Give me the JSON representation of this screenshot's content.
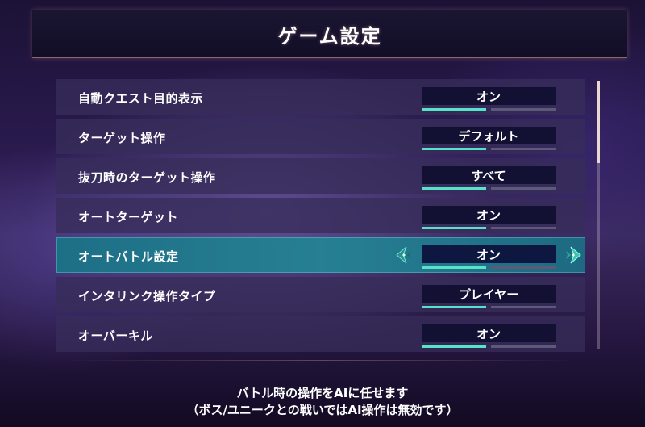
{
  "header": {
    "title": "ゲーム設定"
  },
  "settings": [
    {
      "label": "自動クエスト目的表示",
      "value": "オン"
    },
    {
      "label": "ターゲット操作",
      "value": "デフォルト"
    },
    {
      "label": "抜刀時のターゲット操作",
      "value": "すべて"
    },
    {
      "label": "オートターゲット",
      "value": "オン"
    },
    {
      "label": "オートバトル設定",
      "value": "オン"
    },
    {
      "label": "インタリンク操作タイプ",
      "value": "プレイヤー"
    },
    {
      "label": "オーバーキル",
      "value": "オン"
    }
  ],
  "description": {
    "line1": "バトル時の操作をAIに任せます",
    "line2": "（ボス/ユニークとの戦いではAI操作は無効です）"
  },
  "colors": {
    "accent": "#56e3c7",
    "selected_row": "#277f93",
    "header_border": "#e6b496"
  },
  "icons": {
    "prev": "diamond-arrow-left-icon",
    "next": "diamond-arrow-right-icon"
  }
}
